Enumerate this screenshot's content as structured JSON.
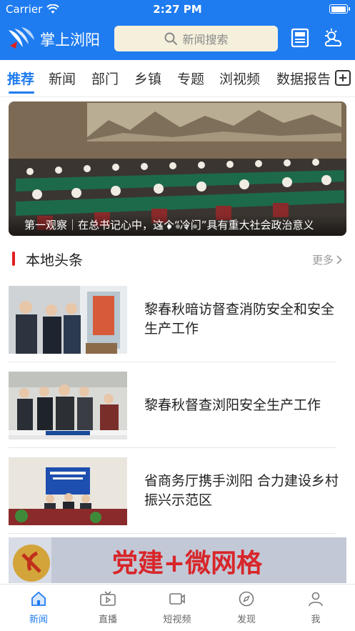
{
  "status_bar": {
    "carrier": "Carrier",
    "time": "2:27 PM",
    "battery_level": 1.0
  },
  "app_bar": {
    "title": "掌上浏阳",
    "search_placeholder": "新闻搜索",
    "icons": [
      "logo-icon",
      "search-icon",
      "newspaper-icon",
      "weather-icon"
    ]
  },
  "tabs": {
    "items": [
      {
        "label": "推荐",
        "active": true
      },
      {
        "label": "新闻"
      },
      {
        "label": "部门"
      },
      {
        "label": "乡镇"
      },
      {
        "label": "专题"
      },
      {
        "label": "浏视频"
      },
      {
        "label": "数据报告"
      }
    ]
  },
  "banner": {
    "caption": "第一观察｜在总书记心中，这个“冷门”具有重大社会政治意义",
    "slides_total": 5,
    "active_slide": 1
  },
  "section": {
    "title": "本地头条",
    "more": "更多"
  },
  "news": [
    {
      "title": "黎春秋暗访督查消防安全和安全生产工作"
    },
    {
      "title": "黎春秋督查浏阳安全生产工作"
    },
    {
      "title": "省商务厅携手浏阳 合力建设乡村振兴示范区"
    }
  ],
  "ad_banner": {
    "text": "党建+微网格"
  },
  "bottom_nav": {
    "items": [
      {
        "label": "新闻",
        "icon": "home-icon",
        "active": true
      },
      {
        "label": "直播",
        "icon": "tv-icon"
      },
      {
        "label": "短视频",
        "icon": "video-icon"
      },
      {
        "label": "发现",
        "icon": "compass-icon"
      },
      {
        "label": "我",
        "icon": "person-icon"
      }
    ]
  },
  "colors": {
    "primary": "#1f7cf0",
    "accent_red": "#e02020",
    "search_bg": "#f5f0dc"
  }
}
